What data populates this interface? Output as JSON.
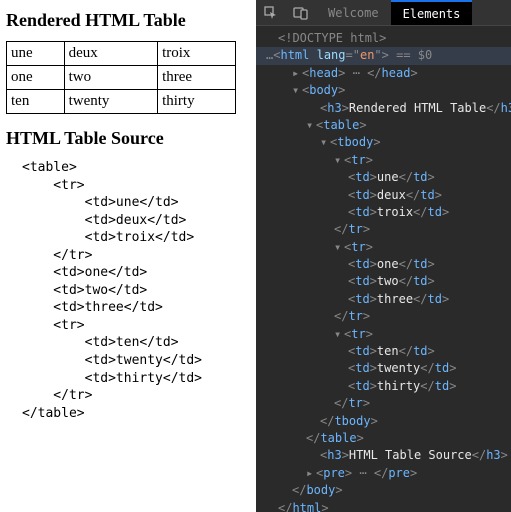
{
  "left": {
    "heading1": "Rendered HTML Table",
    "heading2": "HTML Table Source",
    "table": {
      "rows": [
        [
          "une",
          "deux",
          "troix"
        ],
        [
          "one",
          "two",
          "three"
        ],
        [
          "ten",
          "twenty",
          "thirty"
        ]
      ]
    },
    "source_lines": [
      "<table>",
      "    <tr>",
      "        <td>une</td>",
      "        <td>deux</td>",
      "        <td>troix</td>",
      "    </tr>",
      "    <td>one</td>",
      "    <td>two</td>",
      "    <td>three</td>",
      "    <tr>",
      "        <td>ten</td>",
      "        <td>twenty</td>",
      "        <td>thirty</td>",
      "    </tr>",
      "</table>"
    ]
  },
  "devtools": {
    "tabs": {
      "welcome": "Welcome",
      "elements": "Elements"
    },
    "doctype": "<!DOCTYPE html>",
    "html_open": {
      "tag": "html",
      "attr": "lang",
      "val": "en",
      "trail": " == $0"
    },
    "head": {
      "tag": "head"
    },
    "body": {
      "tag": "body"
    },
    "h3a": {
      "tag": "h3",
      "text": "Rendered HTML Table"
    },
    "h3b": {
      "tag": "h3",
      "text": "HTML Table Source"
    },
    "table": {
      "tag": "table"
    },
    "tbody": {
      "tag": "tbody"
    },
    "tr": {
      "tag": "tr"
    },
    "td": {
      "tag": "td"
    },
    "cells": {
      "r1": [
        "une",
        "deux",
        "troix"
      ],
      "r2": [
        "one",
        "two",
        "three"
      ],
      "r3": [
        "ten",
        "twenty",
        "thirty"
      ]
    },
    "pre": {
      "tag": "pre"
    },
    "ellipsis_prefix": "…"
  }
}
